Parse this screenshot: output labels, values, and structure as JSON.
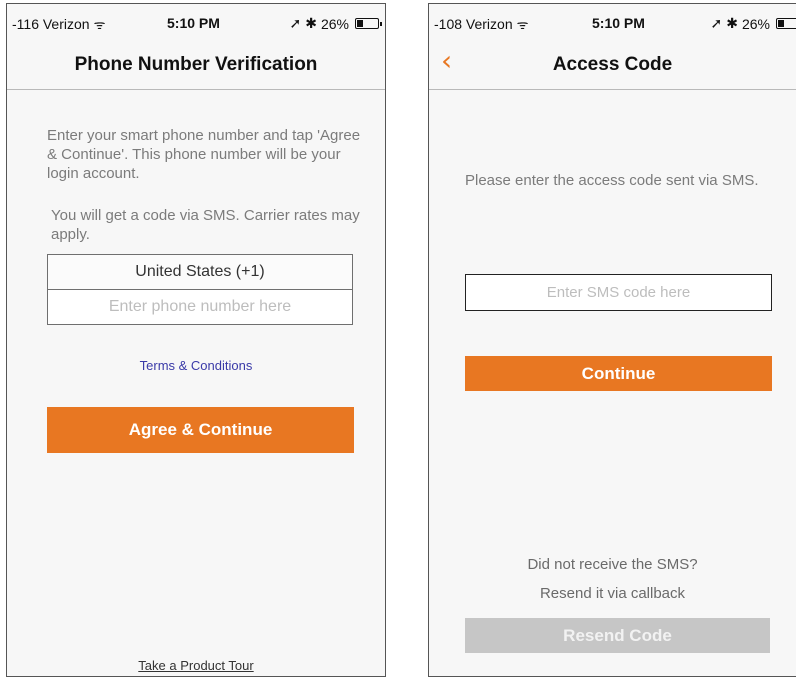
{
  "left_screen": {
    "status": {
      "carrier": "-116 Verizon",
      "time": "5:10 PM",
      "battery": "26%",
      "battery_level": 0.26
    },
    "title": "Phone Number Verification",
    "instructions": "Enter your smart phone number and tap 'Agree & Continue'. This phone number will be your login account.",
    "sms_note": "You will get a code via SMS. Carrier rates may apply.",
    "country": "United States (+1)",
    "phone_placeholder": "Enter phone number here",
    "terms_label": "Terms & Conditions",
    "agree_label": "Agree & Continue",
    "tour_label": "Take a Product Tour"
  },
  "right_screen": {
    "status": {
      "carrier": "-108 Verizon",
      "time": "5:10 PM",
      "battery": "26%",
      "battery_level": 0.26
    },
    "title": "Access Code",
    "back_icon": "chevron-left-icon",
    "instructions": "Please enter the access code sent via SMS.",
    "sms_placeholder": "Enter SMS code here",
    "continue_label": "Continue",
    "not_received": "Did not receive the SMS?",
    "resend_via": "Resend it via callback",
    "resend_label": "Resend Code"
  },
  "colors": {
    "accent": "#e87722",
    "link": "#3a3aa8",
    "disabled": "#c6c6c6"
  }
}
